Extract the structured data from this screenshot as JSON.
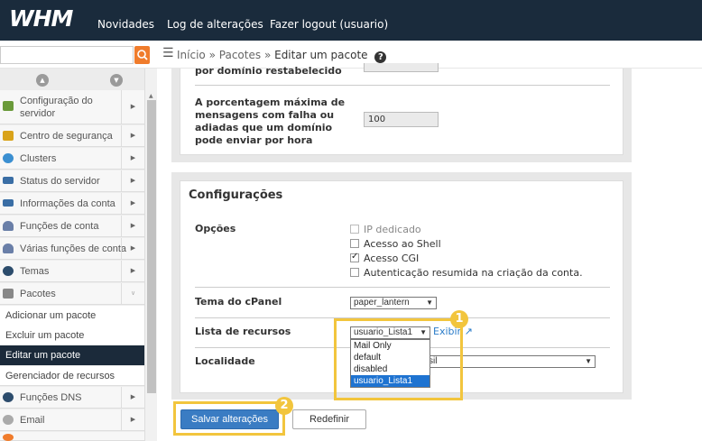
{
  "header": {
    "logo": "WHM",
    "links": [
      "Novidades",
      "Log de alterações",
      "Fazer logout (usuario)"
    ]
  },
  "search": {
    "value": "",
    "placeholder": ""
  },
  "breadcrumb": {
    "items": [
      "Início",
      "Pacotes"
    ],
    "separator": "»",
    "current": "Editar um pacote"
  },
  "sidebar": {
    "items": [
      {
        "label": "Configuração do servidor",
        "icon": "server-config-icon",
        "color": "#6a9a3a"
      },
      {
        "label": "Centro de segurança",
        "icon": "lock-icon",
        "color": "#d9a31a"
      },
      {
        "label": "Clusters",
        "icon": "clusters-icon",
        "color": "#3b8fd1"
      },
      {
        "label": "Status do servidor",
        "icon": "server-status-icon",
        "color": "#3a6ea5"
      },
      {
        "label": "Informações da conta",
        "icon": "account-info-icon",
        "color": "#3a6ea5"
      },
      {
        "label": "Funções de conta",
        "icon": "user-icon",
        "color": "#6a7fa8"
      },
      {
        "label": "Várias funções de conta",
        "icon": "users-icon",
        "color": "#6a7fa8"
      },
      {
        "label": "Temas",
        "icon": "themes-icon",
        "color": "#2c4c6c"
      },
      {
        "label": "Pacotes",
        "icon": "package-icon",
        "color": "#888888"
      }
    ],
    "subitems": [
      "Adicionar um pacote",
      "Excluir um pacote",
      "Editar um pacote",
      "Gerenciador de recursos"
    ],
    "bottom_items": [
      {
        "label": "Funções DNS",
        "icon": "dns-icon",
        "color": "#2c4c6c"
      },
      {
        "label": "Email",
        "icon": "email-icon",
        "color": "#aaaaaa"
      }
    ]
  },
  "prev_section": {
    "truncated_label": "por domínio restabelecido",
    "field_label": "A porcentagem máxima de mensagens com falha ou adiadas que um domínio pode enviar por hora",
    "field_value": "100"
  },
  "config": {
    "title": "Configurações",
    "options_label": "Opções",
    "options": [
      {
        "label": "IP dedicado",
        "checked": false,
        "disabled": true
      },
      {
        "label": "Acesso ao Shell",
        "checked": false,
        "disabled": false
      },
      {
        "label": "Acesso CGI",
        "checked": true,
        "disabled": false
      },
      {
        "label": "Autenticação resumida na criação da conta.",
        "checked": false,
        "disabled": false
      }
    ],
    "theme_label": "Tema do cPanel",
    "theme_value": "paper_lantern",
    "feature_label": "Lista de recursos",
    "feature_value": "usuario_Lista1",
    "feature_options": [
      "Mail Only",
      "default",
      "disabled",
      "usuario_Lista1"
    ],
    "feature_selected": "usuario_Lista1",
    "show_link": "Exibir",
    "locale_label": "Localidade",
    "locale_value": "sil"
  },
  "actions": {
    "save": "Salvar alterações",
    "reset": "Redefinir"
  },
  "callouts": {
    "first": "1",
    "second": "2",
    "color": "#f2c53d"
  }
}
